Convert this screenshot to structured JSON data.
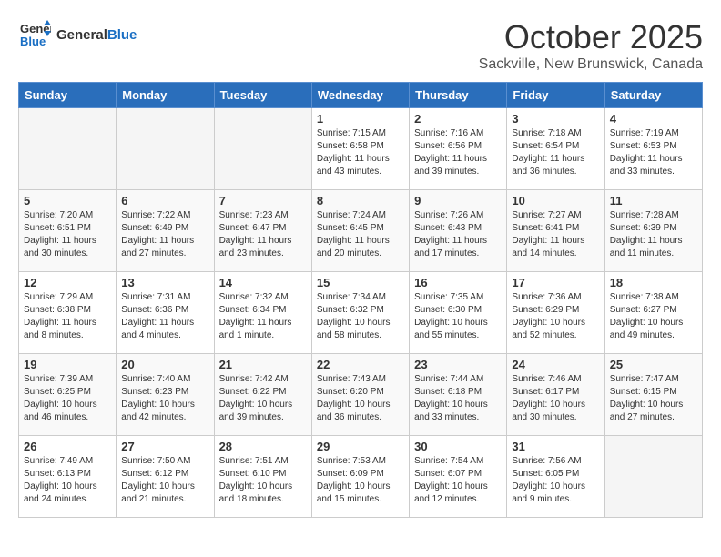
{
  "header": {
    "logo_general": "General",
    "logo_blue": "Blue",
    "month": "October 2025",
    "location": "Sackville, New Brunswick, Canada"
  },
  "days_of_week": [
    "Sunday",
    "Monday",
    "Tuesday",
    "Wednesday",
    "Thursday",
    "Friday",
    "Saturday"
  ],
  "weeks": [
    [
      {
        "day": "",
        "info": ""
      },
      {
        "day": "",
        "info": ""
      },
      {
        "day": "",
        "info": ""
      },
      {
        "day": "1",
        "info": "Sunrise: 7:15 AM\nSunset: 6:58 PM\nDaylight: 11 hours\nand 43 minutes."
      },
      {
        "day": "2",
        "info": "Sunrise: 7:16 AM\nSunset: 6:56 PM\nDaylight: 11 hours\nand 39 minutes."
      },
      {
        "day": "3",
        "info": "Sunrise: 7:18 AM\nSunset: 6:54 PM\nDaylight: 11 hours\nand 36 minutes."
      },
      {
        "day": "4",
        "info": "Sunrise: 7:19 AM\nSunset: 6:53 PM\nDaylight: 11 hours\nand 33 minutes."
      }
    ],
    [
      {
        "day": "5",
        "info": "Sunrise: 7:20 AM\nSunset: 6:51 PM\nDaylight: 11 hours\nand 30 minutes."
      },
      {
        "day": "6",
        "info": "Sunrise: 7:22 AM\nSunset: 6:49 PM\nDaylight: 11 hours\nand 27 minutes."
      },
      {
        "day": "7",
        "info": "Sunrise: 7:23 AM\nSunset: 6:47 PM\nDaylight: 11 hours\nand 23 minutes."
      },
      {
        "day": "8",
        "info": "Sunrise: 7:24 AM\nSunset: 6:45 PM\nDaylight: 11 hours\nand 20 minutes."
      },
      {
        "day": "9",
        "info": "Sunrise: 7:26 AM\nSunset: 6:43 PM\nDaylight: 11 hours\nand 17 minutes."
      },
      {
        "day": "10",
        "info": "Sunrise: 7:27 AM\nSunset: 6:41 PM\nDaylight: 11 hours\nand 14 minutes."
      },
      {
        "day": "11",
        "info": "Sunrise: 7:28 AM\nSunset: 6:39 PM\nDaylight: 11 hours\nand 11 minutes."
      }
    ],
    [
      {
        "day": "12",
        "info": "Sunrise: 7:29 AM\nSunset: 6:38 PM\nDaylight: 11 hours\nand 8 minutes."
      },
      {
        "day": "13",
        "info": "Sunrise: 7:31 AM\nSunset: 6:36 PM\nDaylight: 11 hours\nand 4 minutes."
      },
      {
        "day": "14",
        "info": "Sunrise: 7:32 AM\nSunset: 6:34 PM\nDaylight: 11 hours\nand 1 minute."
      },
      {
        "day": "15",
        "info": "Sunrise: 7:34 AM\nSunset: 6:32 PM\nDaylight: 10 hours\nand 58 minutes."
      },
      {
        "day": "16",
        "info": "Sunrise: 7:35 AM\nSunset: 6:30 PM\nDaylight: 10 hours\nand 55 minutes."
      },
      {
        "day": "17",
        "info": "Sunrise: 7:36 AM\nSunset: 6:29 PM\nDaylight: 10 hours\nand 52 minutes."
      },
      {
        "day": "18",
        "info": "Sunrise: 7:38 AM\nSunset: 6:27 PM\nDaylight: 10 hours\nand 49 minutes."
      }
    ],
    [
      {
        "day": "19",
        "info": "Sunrise: 7:39 AM\nSunset: 6:25 PM\nDaylight: 10 hours\nand 46 minutes."
      },
      {
        "day": "20",
        "info": "Sunrise: 7:40 AM\nSunset: 6:23 PM\nDaylight: 10 hours\nand 42 minutes."
      },
      {
        "day": "21",
        "info": "Sunrise: 7:42 AM\nSunset: 6:22 PM\nDaylight: 10 hours\nand 39 minutes."
      },
      {
        "day": "22",
        "info": "Sunrise: 7:43 AM\nSunset: 6:20 PM\nDaylight: 10 hours\nand 36 minutes."
      },
      {
        "day": "23",
        "info": "Sunrise: 7:44 AM\nSunset: 6:18 PM\nDaylight: 10 hours\nand 33 minutes."
      },
      {
        "day": "24",
        "info": "Sunrise: 7:46 AM\nSunset: 6:17 PM\nDaylight: 10 hours\nand 30 minutes."
      },
      {
        "day": "25",
        "info": "Sunrise: 7:47 AM\nSunset: 6:15 PM\nDaylight: 10 hours\nand 27 minutes."
      }
    ],
    [
      {
        "day": "26",
        "info": "Sunrise: 7:49 AM\nSunset: 6:13 PM\nDaylight: 10 hours\nand 24 minutes."
      },
      {
        "day": "27",
        "info": "Sunrise: 7:50 AM\nSunset: 6:12 PM\nDaylight: 10 hours\nand 21 minutes."
      },
      {
        "day": "28",
        "info": "Sunrise: 7:51 AM\nSunset: 6:10 PM\nDaylight: 10 hours\nand 18 minutes."
      },
      {
        "day": "29",
        "info": "Sunrise: 7:53 AM\nSunset: 6:09 PM\nDaylight: 10 hours\nand 15 minutes."
      },
      {
        "day": "30",
        "info": "Sunrise: 7:54 AM\nSunset: 6:07 PM\nDaylight: 10 hours\nand 12 minutes."
      },
      {
        "day": "31",
        "info": "Sunrise: 7:56 AM\nSunset: 6:05 PM\nDaylight: 10 hours\nand 9 minutes."
      },
      {
        "day": "",
        "info": ""
      }
    ]
  ]
}
